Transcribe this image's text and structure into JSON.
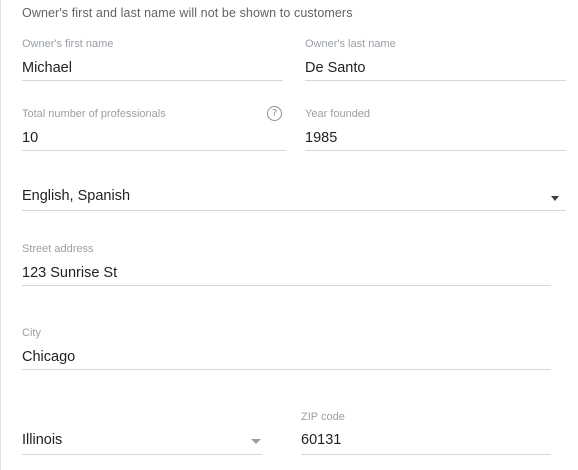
{
  "notice": "Owner's first and last name will not be shown to customers",
  "owner_first_name": {
    "label": "Owner's first name",
    "value": "Michael"
  },
  "owner_last_name": {
    "label": "Owner's last name",
    "value": "De Santo"
  },
  "professionals": {
    "label": "Total number of professionals",
    "value": "10",
    "help_icon": "question-circle-icon"
  },
  "year_founded": {
    "label": "Year founded",
    "value": "1985"
  },
  "languages": {
    "value": "English, Spanish",
    "icon": "dropdown-arrow-icon"
  },
  "street_address": {
    "label": "Street address",
    "value": "123 Sunrise St"
  },
  "city": {
    "label": "City",
    "value": "Chicago"
  },
  "state": {
    "value": "Illinois",
    "icon": "dropdown-arrow-icon"
  },
  "zip": {
    "label": "ZIP code",
    "value": "60131"
  }
}
